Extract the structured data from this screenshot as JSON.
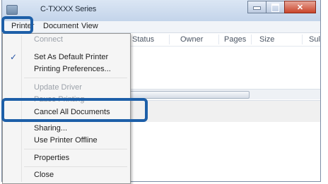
{
  "window": {
    "title": "C-TXXXX Series",
    "controls": {
      "minimize": "–",
      "maximize": "□",
      "close": "✕"
    }
  },
  "menubar": {
    "printer": "Printer",
    "document": "Document",
    "view": "View"
  },
  "columns": [
    "Status",
    "Owner",
    "Pages",
    "Size",
    "Sul"
  ],
  "printer_menu": {
    "connect": "Connect",
    "set_default": "Set As Default Printer",
    "preferences": "Printing Preferences...",
    "update_driver": "Update Driver",
    "pause": "Pause Printing",
    "cancel_all": "Cancel All Documents",
    "sharing": "Sharing...",
    "offline": "Use Printer Offline",
    "properties": "Properties",
    "close": "Close",
    "check_mark": "✓"
  },
  "colors": {
    "highlight": "#1d5fa8"
  }
}
